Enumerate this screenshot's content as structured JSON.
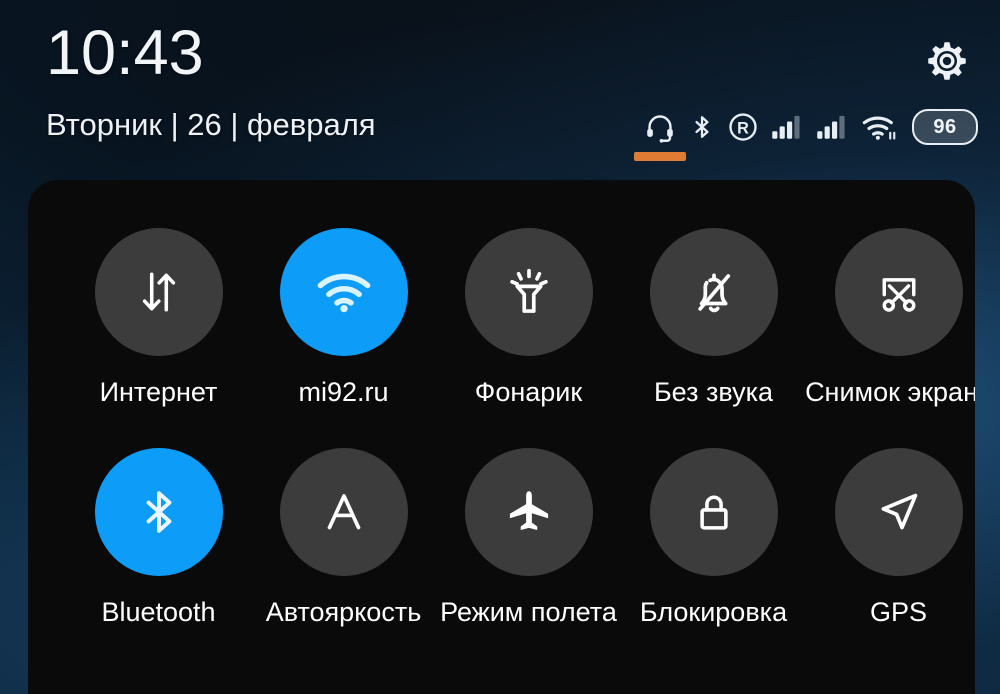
{
  "statusbar": {
    "time": "10:43",
    "date": "Вторник | 26 | февраля",
    "settings_icon": "gear-icon",
    "icons": [
      {
        "name": "headset-icon",
        "label": "headset"
      },
      {
        "name": "bluetooth-icon",
        "label": "bluetooth"
      },
      {
        "name": "roaming-icon",
        "label": "R"
      },
      {
        "name": "signal-sim1-icon",
        "label": "signal 3/4"
      },
      {
        "name": "signal-sim2-icon",
        "label": "signal 3/4"
      },
      {
        "name": "wifi-icon",
        "label": "wifi"
      }
    ],
    "battery_level": "96",
    "accent_orange": "#e07b34"
  },
  "quick_settings": {
    "active_color": "#0d9cf7",
    "inactive_color": "#3c3c3c",
    "rows": [
      {
        "tiles": [
          {
            "label": "Интернет",
            "icon": "data-transfer-icon",
            "active": false
          },
          {
            "label": "mi92.ru",
            "icon": "wifi-icon",
            "active": true
          },
          {
            "label": "Фонарик",
            "icon": "flashlight-icon",
            "active": false
          },
          {
            "label": "Без звука",
            "icon": "bell-off-icon",
            "active": false
          },
          {
            "label": "Снимок экрана",
            "icon": "screenshot-scissors-icon",
            "active": false
          }
        ]
      },
      {
        "tiles": [
          {
            "label": "Bluetooth",
            "icon": "bluetooth-icon",
            "active": true
          },
          {
            "label": "Автояркость",
            "icon": "auto-brightness-icon",
            "active": false
          },
          {
            "label": "Режим полета",
            "icon": "airplane-icon",
            "active": false
          },
          {
            "label": "Блокировка",
            "icon": "lock-icon",
            "active": false
          },
          {
            "label": "GPS",
            "icon": "navigation-arrow-icon",
            "active": false
          }
        ]
      }
    ]
  }
}
